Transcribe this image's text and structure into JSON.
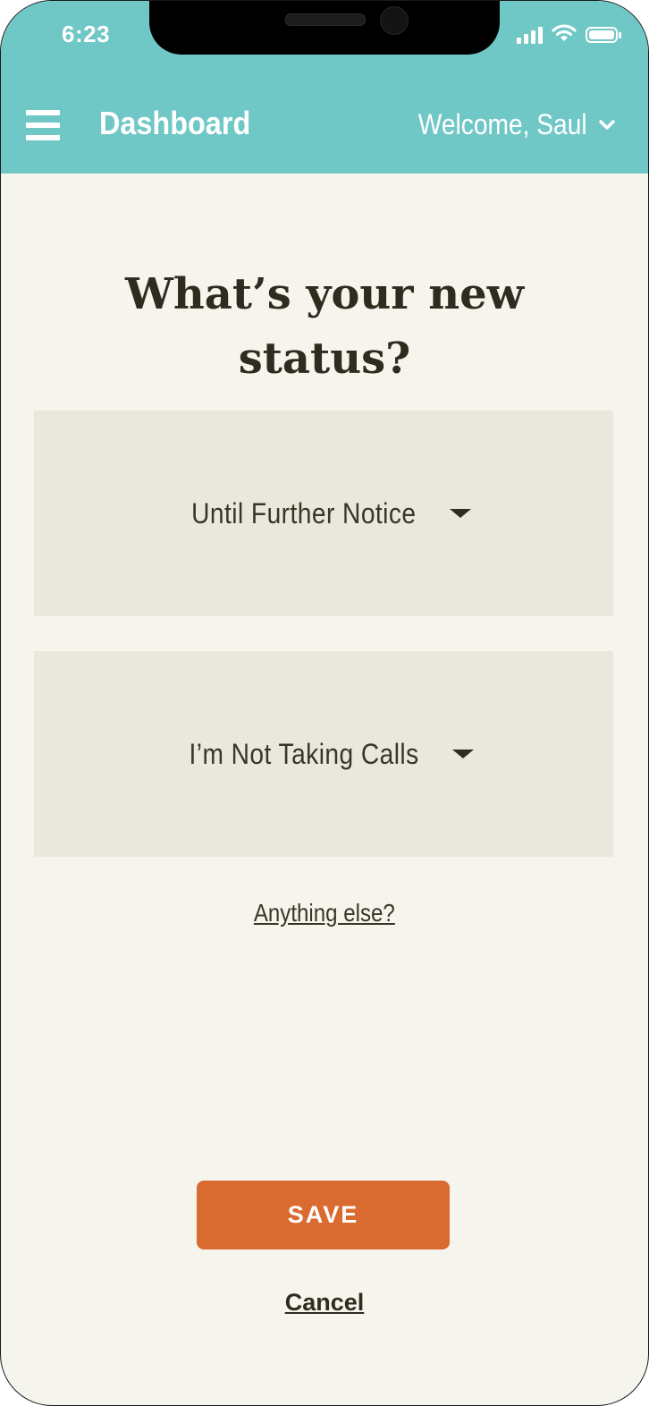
{
  "status_bar": {
    "time": "6:23",
    "icons": [
      "signal-icon",
      "wifi-icon",
      "battery-icon"
    ]
  },
  "header": {
    "menu_icon": "hamburger-menu-icon",
    "title": "Dashboard",
    "welcome": "Welcome, Saul",
    "welcome_icon": "chevron-down-icon"
  },
  "main": {
    "heading_line1": "What’s your new",
    "heading_line2": "status?",
    "duration_select": {
      "value": "Until Further Notice",
      "icon": "caret-down-icon"
    },
    "status_select": {
      "value": "I’m Not Taking Calls",
      "icon": "caret-down-icon"
    },
    "anything_else_link": "Anything else?",
    "save_label": "SAVE",
    "cancel_label": "Cancel"
  },
  "colors": {
    "header_bg": "#6fc7c6",
    "page_bg": "#f5f5ee",
    "select_bg": "#e8e8dd",
    "primary_button": "#d96b30",
    "text_dark": "#2f2c1f"
  }
}
